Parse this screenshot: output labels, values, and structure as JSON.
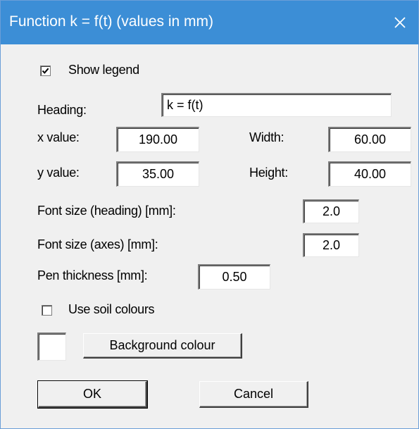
{
  "window": {
    "title": "Function k = f(t) (values in mm)",
    "close_icon": "close-icon"
  },
  "show_legend": {
    "label": "Show legend",
    "checked": true
  },
  "heading": {
    "label": "Heading:",
    "value": "k = f(t)"
  },
  "x_value": {
    "label": "x value:",
    "value": "190.00"
  },
  "width": {
    "label": "Width:",
    "value": "60.00"
  },
  "y_value": {
    "label": "y value:",
    "value": "35.00"
  },
  "height": {
    "label": "Height:",
    "value": "40.00"
  },
  "font_size_heading": {
    "label": "Font size (heading) [mm]:",
    "value": "2.0"
  },
  "font_size_axes": {
    "label": "Font size (axes) [mm]:",
    "value": "2.0"
  },
  "pen_thickness": {
    "label": "Pen thickness [mm]:",
    "value": "0.50"
  },
  "use_soil_colours": {
    "label": "Use soil colours",
    "checked": false
  },
  "background_colour": {
    "label": "Background colour",
    "swatch_color": "#ffffff"
  },
  "buttons": {
    "ok": "OK",
    "cancel": "Cancel"
  },
  "colors": {
    "titlebar": "#3c8ed6",
    "dialog_bg": "#f0f0f0"
  }
}
